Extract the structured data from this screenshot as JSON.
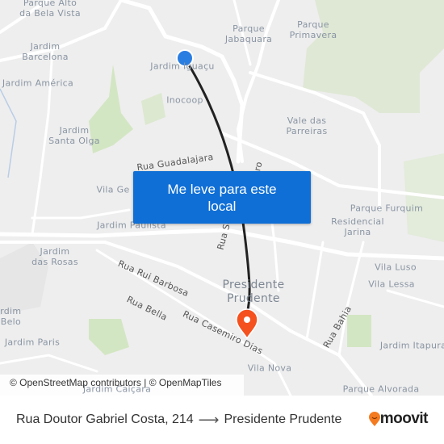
{
  "map": {
    "labels": {
      "bela_vista": "Parque Alto\nda Bela Vista",
      "barcelona": "Jardim\nBarcelona",
      "america": "Jardim América",
      "iguacu": "Jardim Iguaçu",
      "inocoop": "Inocoop",
      "jabaquara": "Parque\nJabaquara",
      "primavera": "Parque\nPrimavera",
      "parreiras": "Vale das\nParreiras",
      "santa_olga": "Jardim\nSanta Olga",
      "vila_ge": "Vila Ge",
      "paulista": "Jardim Paulista",
      "furquim": "Parque Furquim",
      "jarina": "Residencial\nJarina",
      "rosas": "Jardim\ndas Rosas",
      "luso": "Vila Luso",
      "lessa": "Vila Lessa",
      "belo": "Jardim\no Belo",
      "paris": "Jardim Paris",
      "itapura": "Jardim Itapura",
      "vila_nova": "Vila Nova",
      "caicara": "Jardim Caiçara",
      "alvorada": "Parque Alvorada",
      "city": "Presidente\nPrudente"
    },
    "streets": {
      "guadalajara": "Rua Guadalajara",
      "se": "Rua Se",
      "ro": "ro",
      "rui_barbosa": "Rua Rui Barbosa",
      "bella": "Rua Bella",
      "casemiro": "Rua Casemiro Dias",
      "bahia": "Rua Bahia"
    },
    "origin_marker_color": "#2a7de1",
    "destination_marker_color": "#f4511e",
    "route_color": "#222222",
    "attribution": "© OpenStreetMap contributors | © OpenMapTiles"
  },
  "cta": {
    "label": "Me leve para este\nlocal",
    "color": "#0f6fd6"
  },
  "footer": {
    "origin": "Rua Doutor Gabriel Costa, 214",
    "arrow": "⟶",
    "destination": "Presidente Prudente",
    "brand": "moovit",
    "brand_color": "#f47b20"
  }
}
